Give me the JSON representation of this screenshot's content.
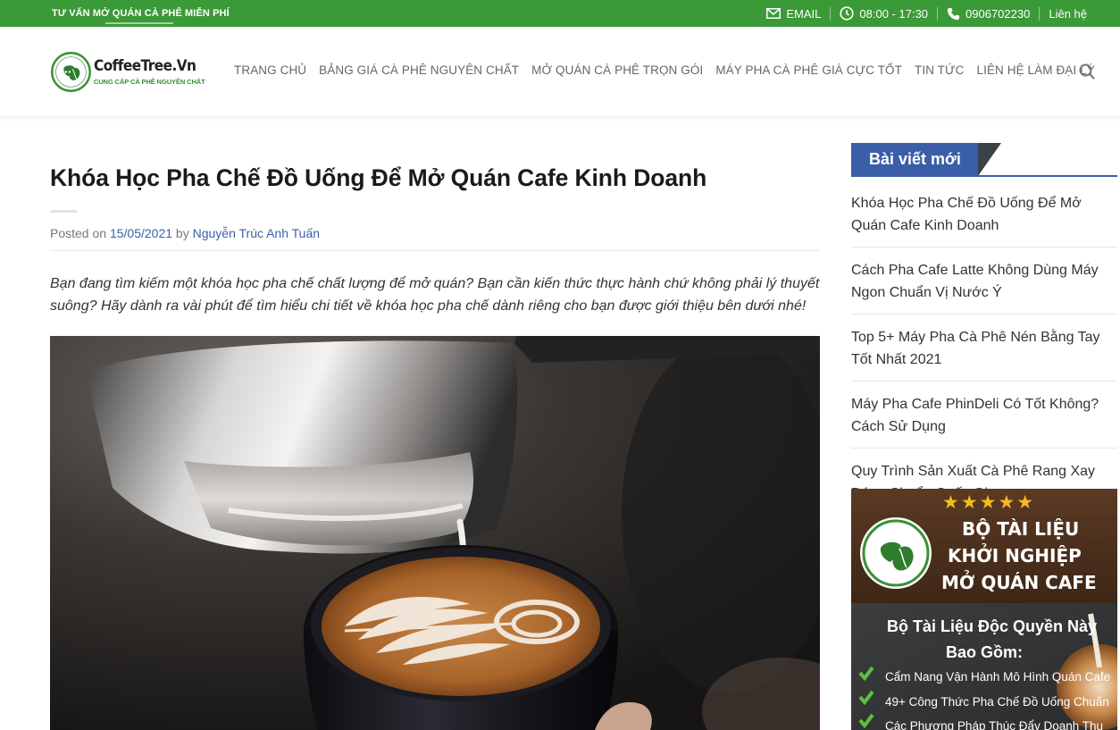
{
  "topbar": {
    "promo": "TƯ VẤN MỞ QUÁN CÀ PHÊ MIỄN PHÍ",
    "email_label": "EMAIL",
    "hours": "08:00 - 17:30",
    "phone": "0906702230",
    "contact": "Liên hệ"
  },
  "logo": {
    "brand": "CoffeeTree.Vn",
    "tagline": "CUNG CẤP CÀ PHÊ NGUYÊN CHẤT",
    "badge_text": "coffee tree"
  },
  "nav": {
    "items": [
      "TRANG CHỦ",
      "BẢNG GIÁ CÀ PHÊ NGUYÊN CHẤT",
      "MỞ QUÁN CÀ PHÊ TRỌN GÓI",
      "MÁY PHA CÀ PHÊ GIÁ CỰC TỐT",
      "TIN TỨC",
      "LIÊN HỆ LÀM ĐẠI LÝ"
    ]
  },
  "post": {
    "title": "Khóa Học Pha Chế Đồ Uống Để Mở Quán Cafe Kinh Doanh",
    "posted_on": "Posted on",
    "date": "15/05/2021",
    "by": "by",
    "author": "Nguyễn Trúc Anh Tuấn",
    "intro": "Bạn đang tìm kiếm một khóa học pha chế chất lượng để mở quán? Bạn cần kiến thức thực hành chứ không phải lý thuyết suông? Hãy dành ra vài phút để tìm hiểu chi tiết về khóa học pha chế dành riêng cho bạn được giới thiệu bên dưới nhé!"
  },
  "sidebar": {
    "widget_title": "Bài viết mới",
    "recent": [
      "Khóa Học Pha Chế Đồ Uống Để Mở Quán Cafe Kinh Doanh",
      "Cách Pha Cafe Latte Không Dùng Máy Ngon Chuẩn Vị Nước Ý",
      "Top 5+ Máy Pha Cà Phê Nén Bằng Tay Tốt Nhất 2021",
      "Máy Pha Cafe PhinDeli Có Tốt Không? Cách Sử Dụng",
      "Quy Trình Sản Xuất Cà Phê Rang Xay Đúng Chuẩn Quốc Gia"
    ]
  },
  "ad": {
    "stars": "★★★★★",
    "line1": "BỘ TÀI LIỆU",
    "line2": "KHỞI NGHIỆP",
    "line3": "MỞ QUÁN CAFE",
    "sub1": "Bộ Tài Liệu Độc Quyền Này",
    "sub2": "Bao Gồm:",
    "bullets": [
      "Cẩm Nang Vận Hành Mô Hình Quán Cafe",
      "49+ Công Thức Pha Chế Đồ Uống Chuẩn",
      "Các Phương Pháp Thúc Đẩy Doanh Thu"
    ],
    "badge_text": "coffee tree"
  },
  "colors": {
    "topbar_green": "#3b9a38",
    "widget_blue": "#3a5fa8",
    "link_blue": "#3a5fa8"
  }
}
